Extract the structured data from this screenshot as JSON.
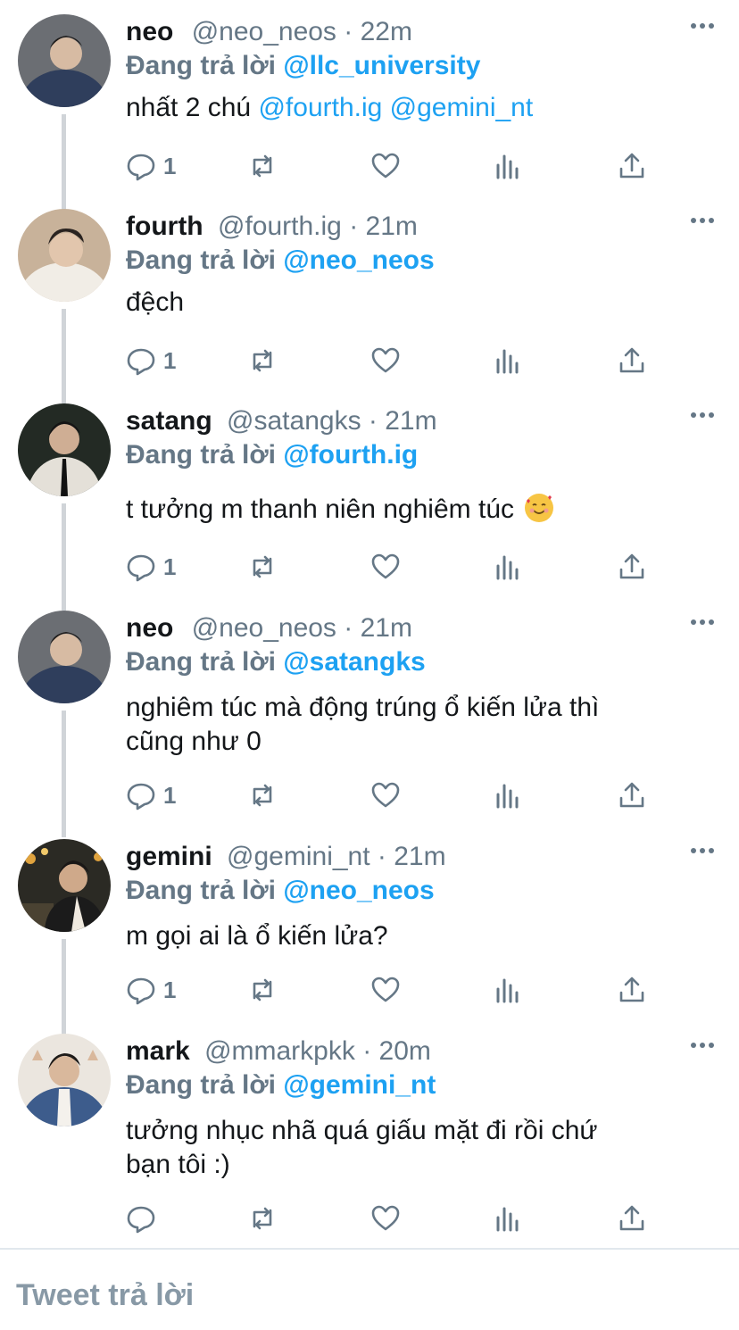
{
  "tweets": [
    {
      "name": "neo",
      "handle": "@neo_neos",
      "time": "22m",
      "reply_prefix": "Đang trả lời",
      "reply_to": "@llc_university",
      "text_before": "nhất 2 chú",
      "mentions": [
        "@fourth.ig",
        "@gemini_nt"
      ],
      "reply_count": "1",
      "avatar_colors": [
        "#3a4a6b",
        "#c9b5a0"
      ]
    },
    {
      "name": "fourth",
      "handle": "@fourth.ig",
      "time": "21m",
      "reply_prefix": "Đang trả lời",
      "reply_to": "@neo_neos",
      "text": "đệch",
      "reply_count": "1",
      "avatar_colors": [
        "#e9e4dc",
        "#9a7b63"
      ]
    },
    {
      "name": "satang",
      "handle": "@satangks",
      "time": "21m",
      "reply_prefix": "Đang trả lời",
      "reply_to": "@fourth.ig",
      "text": "t tưởng m thanh niên nghiêm túc",
      "reply_count": "1",
      "avatar_colors": [
        "#1f2521",
        "#d9d4c8"
      ]
    },
    {
      "name": "neo",
      "handle": "@neo_neos",
      "time": "21m",
      "reply_prefix": "Đang trả lời",
      "reply_to": "@satangks",
      "text_line1": "nghiêm túc mà động trúng ổ kiến lửa thì",
      "text_line2": "cũng như 0",
      "reply_count": "1",
      "avatar_colors": [
        "#3a4a6b",
        "#c9b5a0"
      ]
    },
    {
      "name": "gemini",
      "handle": "@gemini_nt",
      "time": "21m",
      "reply_prefix": "Đang trả lời",
      "reply_to": "@neo_neos",
      "text": "m gọi ai là ổ kiến lửa?",
      "reply_count": "1",
      "avatar_colors": [
        "#2b2a24",
        "#c99a3e"
      ]
    },
    {
      "name": "mark",
      "handle": "@mmarkpkk",
      "time": "20m",
      "reply_prefix": "Đang trả lời",
      "reply_to": "@gemini_nt",
      "text_line1": "tưởng nhục nhã quá giấu mặt đi rồi chứ",
      "text_line2": "bạn tôi :)",
      "reply_count": "",
      "avatar_colors": [
        "#e8e3dc",
        "#3c5a86"
      ]
    }
  ],
  "emoji": "smiling-face-with-hearts",
  "compose": {
    "placeholder": "Tweet trả lời"
  },
  "colors": {
    "accent": "#1da1f2",
    "muted": "#657786",
    "text": "#14171a",
    "thread_line": "#d0d4d8"
  }
}
